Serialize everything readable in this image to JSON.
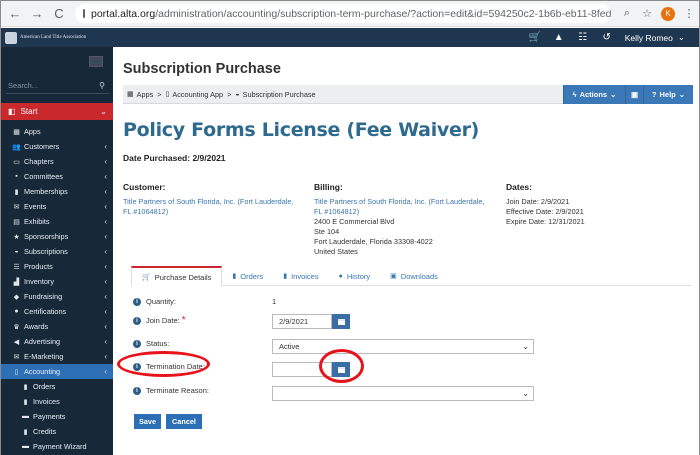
{
  "browser": {
    "url_host": "portal.alta.org",
    "url_path": "/administration/accounting/subscription-term-purchase/?action=edit&id=594250c2-1b6b-eb11-8fed-501ac56a...",
    "avatar_letter": "K"
  },
  "topbar": {
    "logo_text": "American Land Title Association",
    "user_name": "Kelly Romeo"
  },
  "sidebar": {
    "search_placeholder": "Search...",
    "start_label": "Start",
    "items": [
      {
        "label": "Apps",
        "icon": "grid-icon",
        "glyph": "▦",
        "chevron": false
      },
      {
        "label": "Customers",
        "icon": "users-icon",
        "glyph": "👥",
        "chevron": true
      },
      {
        "label": "Chapters",
        "icon": "chapters-icon",
        "glyph": "▭",
        "chevron": true
      },
      {
        "label": "Committees",
        "icon": "briefcase-icon",
        "glyph": "▪",
        "chevron": true
      },
      {
        "label": "Memberships",
        "icon": "book-icon",
        "glyph": "▮",
        "chevron": true
      },
      {
        "label": "Events",
        "icon": "envelope-icon",
        "glyph": "✉",
        "chevron": true
      },
      {
        "label": "Exhibits",
        "icon": "table-icon",
        "glyph": "▤",
        "chevron": true
      },
      {
        "label": "Sponsorships",
        "icon": "star-icon",
        "glyph": "★",
        "chevron": true
      },
      {
        "label": "Subscriptions",
        "icon": "car-icon",
        "glyph": "◒",
        "chevron": true
      },
      {
        "label": "Products",
        "icon": "list-icon",
        "glyph": "☰",
        "chevron": true
      },
      {
        "label": "Inventory",
        "icon": "chart-icon",
        "glyph": "▟",
        "chevron": true
      },
      {
        "label": "Fundraising",
        "icon": "tag-icon",
        "glyph": "◆",
        "chevron": true
      },
      {
        "label": "Certifications",
        "icon": "certificate-icon",
        "glyph": "●",
        "chevron": true
      },
      {
        "label": "Awards",
        "icon": "trophy-icon",
        "glyph": "♛",
        "chevron": true
      },
      {
        "label": "Advertising",
        "icon": "bullhorn-icon",
        "glyph": "◀",
        "chevron": true
      },
      {
        "label": "E-Marketing",
        "icon": "mail-icon",
        "glyph": "✉",
        "chevron": true
      },
      {
        "label": "Accounting",
        "icon": "file-icon",
        "glyph": "▯",
        "chevron": true,
        "active": true
      },
      {
        "label": "Orders",
        "icon": "file-icon",
        "glyph": "▮",
        "chevron": false,
        "sub": true
      },
      {
        "label": "Invoices",
        "icon": "file-icon",
        "glyph": "▮",
        "chevron": false,
        "sub": true
      },
      {
        "label": "Payments",
        "icon": "money-icon",
        "glyph": "▬",
        "chevron": false,
        "sub": true
      },
      {
        "label": "Credits",
        "icon": "file-icon",
        "glyph": "▮",
        "chevron": false,
        "sub": true
      },
      {
        "label": "Payment Wizard",
        "icon": "money-icon",
        "glyph": "▬",
        "chevron": false,
        "sub": true
      }
    ]
  },
  "header": {
    "page_title": "Subscription Purchase",
    "breadcrumb": [
      "Apps",
      "Accounting App",
      "Subscription Purchase"
    ],
    "actions_label": "Actions",
    "help_label": "Help"
  },
  "record": {
    "title": "Policy Forms License (Fee Waiver)",
    "date_purchased": "Date Purchased: 2/9/2021"
  },
  "customer": {
    "heading": "Customer:",
    "name": "Title Partners of South Florida, Inc. (Fort Lauderdale, FL #1064812)"
  },
  "billing": {
    "heading": "Billing:",
    "name": "Title Partners of South Florida, Inc. (Fort Lauderdale, FL #1064812)",
    "lines": [
      "2400 E Commercial Blvd",
      "Ste 104",
      "Fort Lauderdale, Florida 33308-4022",
      "United States"
    ]
  },
  "dates": {
    "heading": "Dates:",
    "lines": [
      "Join Date: 2/9/2021",
      "Effective Date: 2/9/2021",
      "Expire Date: 12/31/2021"
    ]
  },
  "tabs": [
    {
      "label": "Purchase Details",
      "icon": "cart-icon",
      "glyph": "🛒",
      "active": true
    },
    {
      "label": "Orders",
      "icon": "file-icon",
      "glyph": "▮"
    },
    {
      "label": "Invoices",
      "icon": "file-icon",
      "glyph": "▮"
    },
    {
      "label": "History",
      "icon": "history-icon",
      "glyph": "●"
    },
    {
      "label": "Downloads",
      "icon": "download-icon",
      "glyph": "▣"
    }
  ],
  "form": {
    "quantity_label": "Quantity:",
    "quantity_value": "1",
    "join_date_label": "Join Date:",
    "join_date_value": "2/9/2021",
    "status_label": "Status:",
    "status_value": "Active",
    "termination_date_label": "Termination Date:",
    "termination_date_value": "",
    "terminate_reason_label": "Terminate Reason:",
    "terminate_reason_value": "",
    "save_label": "Save",
    "cancel_label": "Cancel"
  },
  "colors": {
    "topbar": "#1e3650",
    "sidebar": "#172838",
    "start": "#c9282d",
    "active": "#2d6fb5",
    "title": "#2d6a8e",
    "highlight": "#e8131a"
  }
}
